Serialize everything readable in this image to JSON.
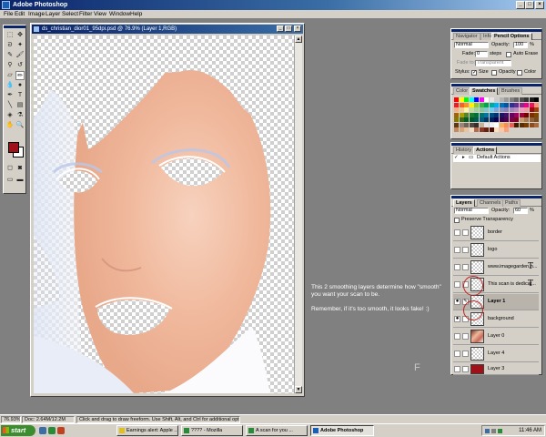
{
  "app": {
    "title": "Adobe Photoshop"
  },
  "menu": [
    "File",
    "Edit",
    "Image",
    "Layer",
    "Select",
    "Filter",
    "View",
    "Window",
    "Help"
  ],
  "document": {
    "title": "ds_christian_dior01_95dpi.psd @ 76.9% (Layer 1,RGB)"
  },
  "annotation": {
    "line1": "This 2 smoothing layers determine how \"smooth\"",
    "line2": "you want your scan to be.",
    "line3": "Remember, if it's too smooth, it looks fake! :)",
    "letter": "F"
  },
  "navigator_palette": {
    "tabs": [
      "Navigator",
      "Info",
      "Pencil Options"
    ],
    "mode_value": "Normal",
    "opacity_label": "Opacity:",
    "opacity_value": "100",
    "opacity_unit": "%",
    "fade_label": "Fade:",
    "fade_value": "0",
    "steps_label": "steps",
    "auto_erase_label": "Auto Erase",
    "fade_to_label": "Fade to:",
    "fade_to_value": "Transparent",
    "stylus_label": "Stylus:",
    "size_label": "Size",
    "opacity_check_label": "Opacity",
    "color_label": "Color"
  },
  "swatches_palette": {
    "tabs": [
      "Color",
      "Swatches",
      "Brushes"
    ],
    "colors": [
      "#ff0000",
      "#ffff00",
      "#00ff00",
      "#00ffff",
      "#0000ff",
      "#ff00ff",
      "#ffffff",
      "#e6e6e6",
      "#cccccc",
      "#b3b3b3",
      "#999999",
      "#808080",
      "#666666",
      "#4d4d4d",
      "#333333",
      "#1a1a1a",
      "#000000",
      "#ee1c24",
      "#f26522",
      "#f7941d",
      "#fff200",
      "#8dc63f",
      "#39b54a",
      "#00a651",
      "#00a99d",
      "#00aeef",
      "#0072bc",
      "#0054a6",
      "#2e3192",
      "#662d91",
      "#92278f",
      "#ec008c",
      "#ed145b",
      "#f69679",
      "#f9ad81",
      "#fdc68a",
      "#fff799",
      "#c4df9b",
      "#a3d39c",
      "#82ca9d",
      "#7accc8",
      "#6dcff6",
      "#7da7d9",
      "#8393ca",
      "#8781bd",
      "#a187be",
      "#bd8cbf",
      "#f49ac1",
      "#f5989d",
      "#9e0b0f",
      "#a0410d",
      "#a36209",
      "#aba000",
      "#598527",
      "#1a7b30",
      "#007236",
      "#00746b",
      "#0076a3",
      "#004b80",
      "#003471",
      "#1b1464",
      "#440e62",
      "#630460",
      "#9e005d",
      "#9e0039",
      "#790000",
      "#7b2e00",
      "#7d4900",
      "#827b00",
      "#406618",
      "#005e20",
      "#005826",
      "#005952",
      "#005b7f",
      "#003663",
      "#002157",
      "#0d004c",
      "#32004b",
      "#4b0049",
      "#7b0046",
      "#7a0026",
      "#c69c6d",
      "#a67c52",
      "#8c6239",
      "#754c24",
      "#603913",
      "#998675",
      "#736357",
      "#534741",
      "#362f2d",
      "#c7b299",
      "#e6e6e6",
      "#f2f2f2",
      "#ffffff",
      "#fbaf5d",
      "#f68e56",
      "#ea6153",
      "#3d1f00",
      "#5c2e00",
      "#7a3d00",
      "#8f4c1f",
      "#a86b3d",
      "#c48a5e",
      "#d9a67a",
      "#e8c4a0",
      "#f2dcc2",
      "#b36b4b",
      "#8a3a24",
      "#6b1f10",
      "#4a0f06",
      "#ffe0c0",
      "#ffc8a0",
      "#ff9f7a"
    ]
  },
  "history_palette": {
    "tabs": [
      "History",
      "Actions"
    ],
    "item": "Default Actions"
  },
  "layers_palette": {
    "tabs": [
      "Layers",
      "Channels",
      "Paths"
    ],
    "mode_value": "Normal",
    "opacity_label": "Opacity:",
    "opacity_value": "60",
    "opacity_unit": "%",
    "preserve_label": "Preserve Transparency",
    "layers": [
      {
        "name": "border",
        "type": "normal",
        "visible": false,
        "thumb": "checker"
      },
      {
        "name": "logo",
        "type": "normal",
        "visible": false,
        "thumb": "checker"
      },
      {
        "name": "www.imagegarden.n...",
        "type": "text",
        "visible": false,
        "thumb": "checker"
      },
      {
        "name": "This scan is dedicat...",
        "type": "text",
        "visible": false,
        "thumb": "checker"
      },
      {
        "name": "Layer 1",
        "type": "normal",
        "visible": true,
        "active": true,
        "thumb": "checker"
      },
      {
        "name": "background",
        "type": "normal",
        "visible": true,
        "thumb": "checker"
      },
      {
        "name": "Layer 0",
        "type": "normal",
        "visible": false,
        "thumb": "face"
      },
      {
        "name": "Layer 4",
        "type": "normal",
        "visible": false,
        "thumb": "checker"
      },
      {
        "name": "Layer 3",
        "type": "normal",
        "visible": false,
        "thumb": "red"
      }
    ]
  },
  "status": {
    "zoom": "76.93%",
    "doc": "Doc: 2.64M/12.2M",
    "hint": "Click and drag to draw freeform. Use Shift, Alt, and Ctrl for additional options."
  },
  "taskbar": {
    "start_label": "start",
    "tasks": [
      "Earnings alert: Apple ...",
      "???? - Mozilla",
      "A scan for you ...",
      "Adobe Photoshop"
    ],
    "active_task": 3,
    "clock": "11:46 AM"
  },
  "colors": {
    "titlebar": "#0a246a",
    "face": "#d4d0c8",
    "workspace": "#808080",
    "foreground_swatch": "#a01018",
    "background_swatch": "#ffffff",
    "highlight_circle": "#c02020"
  }
}
